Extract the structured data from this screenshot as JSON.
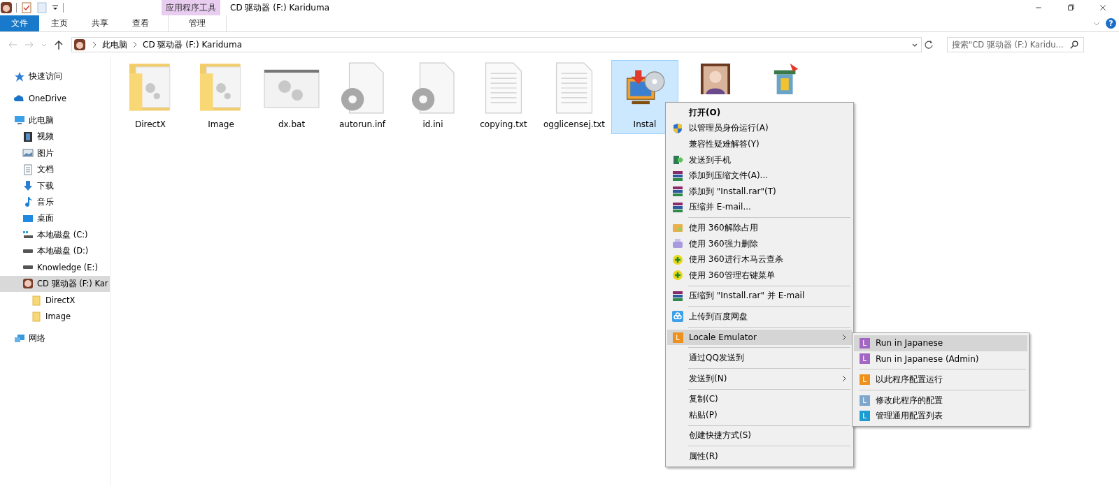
{
  "window": {
    "title": "CD 驱动器 (F:) Kariduma",
    "contextual_group": "应用程序工具",
    "help": "?"
  },
  "ribbon_tabs": [
    {
      "label": "文件",
      "kind": "file"
    },
    {
      "label": "主页",
      "kind": "tab"
    },
    {
      "label": "共享",
      "kind": "tab"
    },
    {
      "label": "查看",
      "kind": "tab"
    },
    {
      "label": "管理",
      "kind": "contextual"
    }
  ],
  "address": {
    "crumbs": [
      "此电脑",
      "CD 驱动器 (F:) Kariduma"
    ]
  },
  "search": {
    "placeholder": "搜索\"CD 驱动器 (F:) Karidu..."
  },
  "sidebar": {
    "items": [
      {
        "label": "快速访问",
        "kind": "star",
        "selected": false
      },
      {
        "label": "OneDrive",
        "kind": "cloud",
        "selected": false
      },
      {
        "label": "此电脑",
        "kind": "pc",
        "selected": false,
        "children": [
          {
            "label": "视频",
            "kind": "video",
            "selected": false
          },
          {
            "label": "图片",
            "kind": "picture",
            "selected": false
          },
          {
            "label": "文档",
            "kind": "doc",
            "selected": false
          },
          {
            "label": "下载",
            "kind": "download",
            "selected": false
          },
          {
            "label": "音乐",
            "kind": "music",
            "selected": false
          },
          {
            "label": "桌面",
            "kind": "desktop",
            "selected": false
          },
          {
            "label": "本地磁盘 (C:)",
            "kind": "sysdrive",
            "selected": false
          },
          {
            "label": "本地磁盘 (D:)",
            "kind": "drive",
            "selected": false
          },
          {
            "label": "Knowledge (E:)",
            "kind": "drive",
            "selected": false
          },
          {
            "label": "CD 驱动器 (F:) Kar",
            "kind": "avatar",
            "selected": true,
            "children": [
              {
                "label": "DirectX",
                "kind": "folder",
                "selected": false
              },
              {
                "label": "Image",
                "kind": "folder",
                "selected": false
              }
            ]
          }
        ]
      },
      {
        "label": "网络",
        "kind": "network",
        "selected": false
      }
    ]
  },
  "files": [
    {
      "label": "DirectX",
      "kind": "folder",
      "selected": false
    },
    {
      "label": "Image",
      "kind": "folder",
      "selected": false
    },
    {
      "label": "dx.bat",
      "kind": "bat",
      "selected": false
    },
    {
      "label": "autorun.inf",
      "kind": "config",
      "selected": false
    },
    {
      "label": "id.ini",
      "kind": "config",
      "selected": false
    },
    {
      "label": "copying.txt",
      "kind": "text",
      "selected": false
    },
    {
      "label": "ogglicensej.txt",
      "kind": "text",
      "selected": false
    },
    {
      "label": "Instal",
      "kind": "installer",
      "selected": true
    },
    {
      "kind": "portrait",
      "selected": false
    },
    {
      "kind": "trash",
      "selected": false
    }
  ],
  "context_menu": [
    {
      "kind": "plain",
      "label": "打开(O)",
      "bold": true,
      "selected": false
    },
    {
      "kind": "shield",
      "label": "以管理员身份运行(A)",
      "selected": false
    },
    {
      "kind": "plain",
      "label": "兼容性疑难解答(Y)",
      "selected": false
    },
    {
      "kind": "phone",
      "label": "发送到手机",
      "selected": false
    },
    {
      "kind": "rar",
      "label": "添加到压缩文件(A)...",
      "selected": false
    },
    {
      "kind": "rar",
      "label": "添加到 \"Install.rar\"(T)",
      "selected": false
    },
    {
      "kind": "rar",
      "label": "压缩并 E-mail...",
      "selected": false
    },
    {
      "kind": "separator"
    },
    {
      "kind": "unlock",
      "label": "使用 360解除占用",
      "selected": false
    },
    {
      "kind": "shred",
      "label": "使用 360强力删除",
      "selected": false
    },
    {
      "kind": "guard",
      "label": "使用 360进行木马云查杀",
      "selected": false
    },
    {
      "kind": "guard",
      "label": "使用 360管理右键菜单",
      "selected": false
    },
    {
      "kind": "separator"
    },
    {
      "kind": "rar",
      "label": "压缩到 \"Install.rar\" 并 E-mail",
      "selected": false
    },
    {
      "kind": "separator"
    },
    {
      "kind": "cloudbox",
      "label": "上传到百度网盘",
      "selected": false
    },
    {
      "kind": "separator"
    },
    {
      "kind": "letter",
      "label": "Locale Emulator",
      "letter": "L",
      "color": "#f0901c",
      "submenu": true,
      "selected": true
    },
    {
      "kind": "separator"
    },
    {
      "kind": "plain",
      "label": "通过QQ发送到",
      "selected": false
    },
    {
      "kind": "separator"
    },
    {
      "kind": "plain",
      "label": "发送到(N)",
      "submenu": true,
      "selected": false
    },
    {
      "kind": "separator"
    },
    {
      "kind": "plain",
      "label": "复制(C)",
      "selected": false
    },
    {
      "kind": "plain",
      "label": "粘贴(P)",
      "selected": false
    },
    {
      "kind": "separator"
    },
    {
      "kind": "plain",
      "label": "创建快捷方式(S)",
      "selected": false
    },
    {
      "kind": "separator"
    },
    {
      "kind": "plain",
      "label": "属性(R)",
      "selected": false
    }
  ],
  "submenu": [
    {
      "kind": "item",
      "label": "Run in Japanese",
      "letter": "L",
      "color": "#a466c4",
      "selected": true
    },
    {
      "kind": "item",
      "label": "Run in Japanese (Admin)",
      "letter": "L",
      "color": "#a466c4",
      "selected": false
    },
    {
      "kind": "separator"
    },
    {
      "kind": "item",
      "label": "以此程序配置运行",
      "letter": "L",
      "color": "#f0901c",
      "selected": false
    },
    {
      "kind": "separator"
    },
    {
      "kind": "item",
      "label": "修改此程序的配置",
      "letter": "L",
      "color": "#7fa6cc",
      "selected": false
    },
    {
      "kind": "item",
      "label": "管理通用配置列表",
      "letter": "L",
      "color": "#1b9dd3",
      "selected": false
    }
  ]
}
